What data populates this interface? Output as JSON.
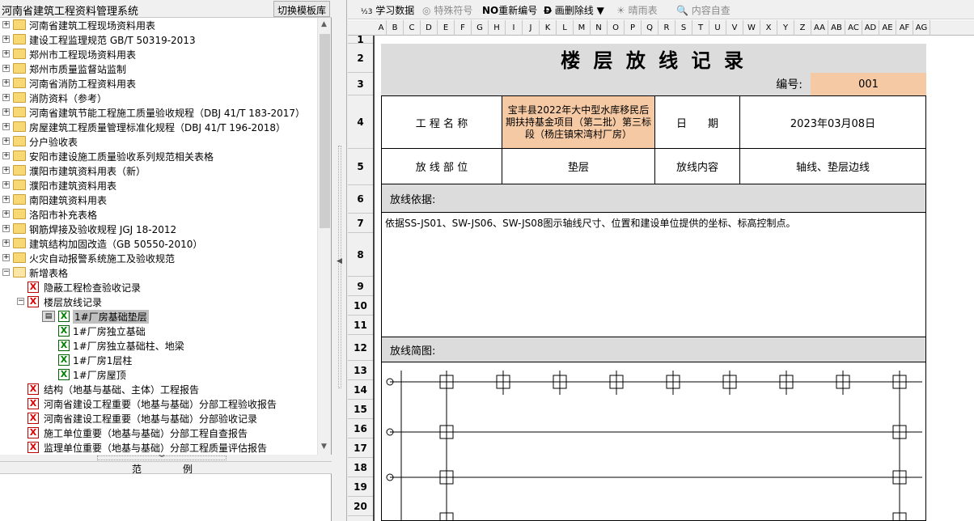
{
  "left_panel": {
    "title": "河南省建筑工程资料管理系统",
    "switch_button": "切换模板库",
    "tree_items": [
      {
        "label": "河南省建筑工程现场资料用表",
        "level": 0,
        "type": "folder"
      },
      {
        "label": "建设工程监理规范 GB/T 50319-2013",
        "level": 0,
        "type": "folder"
      },
      {
        "label": "郑州市工程现场资料用表",
        "level": 0,
        "type": "folder"
      },
      {
        "label": "郑州市质量监督站监制",
        "level": 0,
        "type": "folder"
      },
      {
        "label": "河南省消防工程资料用表",
        "level": 0,
        "type": "folder"
      },
      {
        "label": "消防资料（参考）",
        "level": 0,
        "type": "folder"
      },
      {
        "label": "河南省建筑节能工程施工质量验收规程（DBJ 41/T 183-2017）",
        "level": 0,
        "type": "folder"
      },
      {
        "label": "房屋建筑工程质量管理标准化规程（DBJ 41/T 196-2018）",
        "level": 0,
        "type": "folder"
      },
      {
        "label": "分户验收表",
        "level": 0,
        "type": "folder"
      },
      {
        "label": "安阳市建设施工质量验收系列规范相关表格",
        "level": 0,
        "type": "folder"
      },
      {
        "label": "濮阳市建筑资料用表（新）",
        "level": 0,
        "type": "folder"
      },
      {
        "label": "濮阳市建筑资料用表",
        "level": 0,
        "type": "folder"
      },
      {
        "label": "南阳建筑资料用表",
        "level": 0,
        "type": "folder"
      },
      {
        "label": "洛阳市补充表格",
        "level": 0,
        "type": "folder"
      },
      {
        "label": "钢筋焊接及验收规程 JGJ 18-2012",
        "level": 0,
        "type": "folder"
      },
      {
        "label": "建筑结构加固改造（GB 50550-2010）",
        "level": 0,
        "type": "folder"
      },
      {
        "label": "火灾自动报警系统施工及验收规范",
        "level": 0,
        "type": "folder"
      },
      {
        "label": "新增表格",
        "level": 0,
        "type": "folder-open"
      },
      {
        "label": "隐蔽工程检查验收记录",
        "level": 1,
        "type": "doc-red"
      },
      {
        "label": "楼层放线记录",
        "level": 1,
        "type": "doc-red-expand"
      },
      {
        "label": "1#厂房基础垫层",
        "level": 2,
        "type": "doc-green-selected"
      },
      {
        "label": "1#厂房独立基础",
        "level": 2,
        "type": "doc-green"
      },
      {
        "label": "1#厂房独立基础柱、地梁",
        "level": 2,
        "type": "doc-green"
      },
      {
        "label": "1#厂房1层柱",
        "level": 2,
        "type": "doc-green"
      },
      {
        "label": "1#厂房屋顶",
        "level": 2,
        "type": "doc-green"
      },
      {
        "label": "结构（地基与基础、主体）工程报告",
        "level": 1,
        "type": "doc-red"
      },
      {
        "label": "河南省建设工程重要（地基与基础）分部工程验收报告",
        "level": 1,
        "type": "doc-red"
      },
      {
        "label": "河南省建设工程重要（地基与基础）分部验收记录",
        "level": 1,
        "type": "doc-red"
      },
      {
        "label": "施工单位重要（地基与基础）分部工程自查报告",
        "level": 1,
        "type": "doc-red"
      },
      {
        "label": "监理单位重要（地基与基础）分部工程质量评估报告",
        "level": 1,
        "type": "doc-red"
      }
    ],
    "example_label_1": "范",
    "example_label_2": "例"
  },
  "toolbar": {
    "learn": "学习数据",
    "special": "特殊符号",
    "renumber": "重新编号",
    "strike": "画删除线",
    "weather": "晴雨表",
    "selfcheck": "内容自查"
  },
  "columns": [
    "A",
    "B",
    "C",
    "D",
    "E",
    "F",
    "G",
    "H",
    "I",
    "J",
    "K",
    "L",
    "M",
    "N",
    "O",
    "P",
    "Q",
    "R",
    "S",
    "T",
    "U",
    "V",
    "W",
    "X",
    "Y",
    "Z",
    "AA",
    "AB",
    "AC",
    "AD",
    "AE",
    "AF",
    "AG"
  ],
  "rows": [
    "1",
    "2",
    "3",
    "4",
    "5",
    "6",
    "7",
    "8",
    "9",
    "10",
    "11",
    "12",
    "13",
    "14",
    "15",
    "16",
    "17",
    "18",
    "19",
    "20"
  ],
  "form": {
    "title": "楼 层 放 线 记 录",
    "number_label": "编号:",
    "number_value": "001",
    "project_name_label": "工 程 名 称",
    "project_name_value": "宝丰县2022年大中型水库移民后期扶持基金项目（第二批）第三标段（杨庄镇宋湾村厂房）",
    "date_label": "日　　期",
    "date_value": "2023年03月08日",
    "location_label": "放 线 部 位",
    "location_value": "垫层",
    "content_label": "放线内容",
    "content_value": "轴线、垫层边线",
    "basis_label": "放线依据:",
    "basis_value": "依据SS-JS01、SW-JS06、SW-JS08图示轴线尺寸、位置和建设单位提供的坐标、标高控制点。",
    "sketch_label": "放线简图:"
  },
  "colors": {
    "header_gray": "#dcdcdc",
    "peach": "#f5c9a4",
    "tree_selected": "#c0c0c0"
  }
}
